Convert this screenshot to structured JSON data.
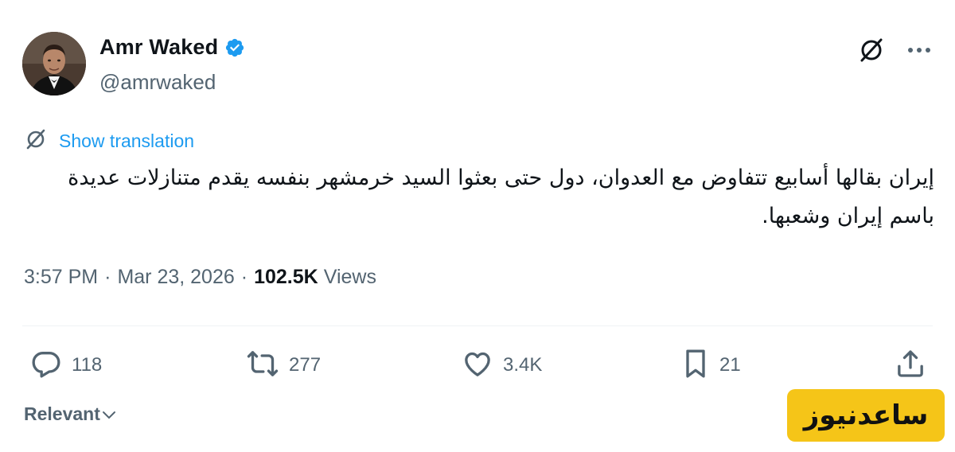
{
  "author": {
    "display_name": "Amr Waked",
    "handle": "@amrwaked",
    "verified": true,
    "avatar_icon": "profile-photo"
  },
  "top_actions": {
    "grok_icon": "grok-icon",
    "more_icon": "more-horizontal-icon"
  },
  "translation": {
    "label": "Show translation",
    "icon": "grok-icon"
  },
  "tweet": {
    "text": "إيران بقالها أسابيع تتفاوض مع العدوان، دول حتى بعثوا السيد خرمشهر بنفسه يقدم متنازلات عديدة باسم إيران وشعبها."
  },
  "meta": {
    "time": "3:57 PM",
    "separator": "·",
    "date": "Mar 23, 2026",
    "views_count": "102.5K",
    "views_label": "Views"
  },
  "engagement": {
    "replies": "118",
    "reposts": "277",
    "likes": "3.4K",
    "bookmarks": "21"
  },
  "sort": {
    "label": "Relevant"
  },
  "watermark": {
    "text": "ساعدنیوز"
  },
  "colors": {
    "link_blue": "#1d9bf0",
    "secondary_text": "#536471",
    "primary_text": "#0f1419",
    "watermark_bg": "#f5c518"
  }
}
